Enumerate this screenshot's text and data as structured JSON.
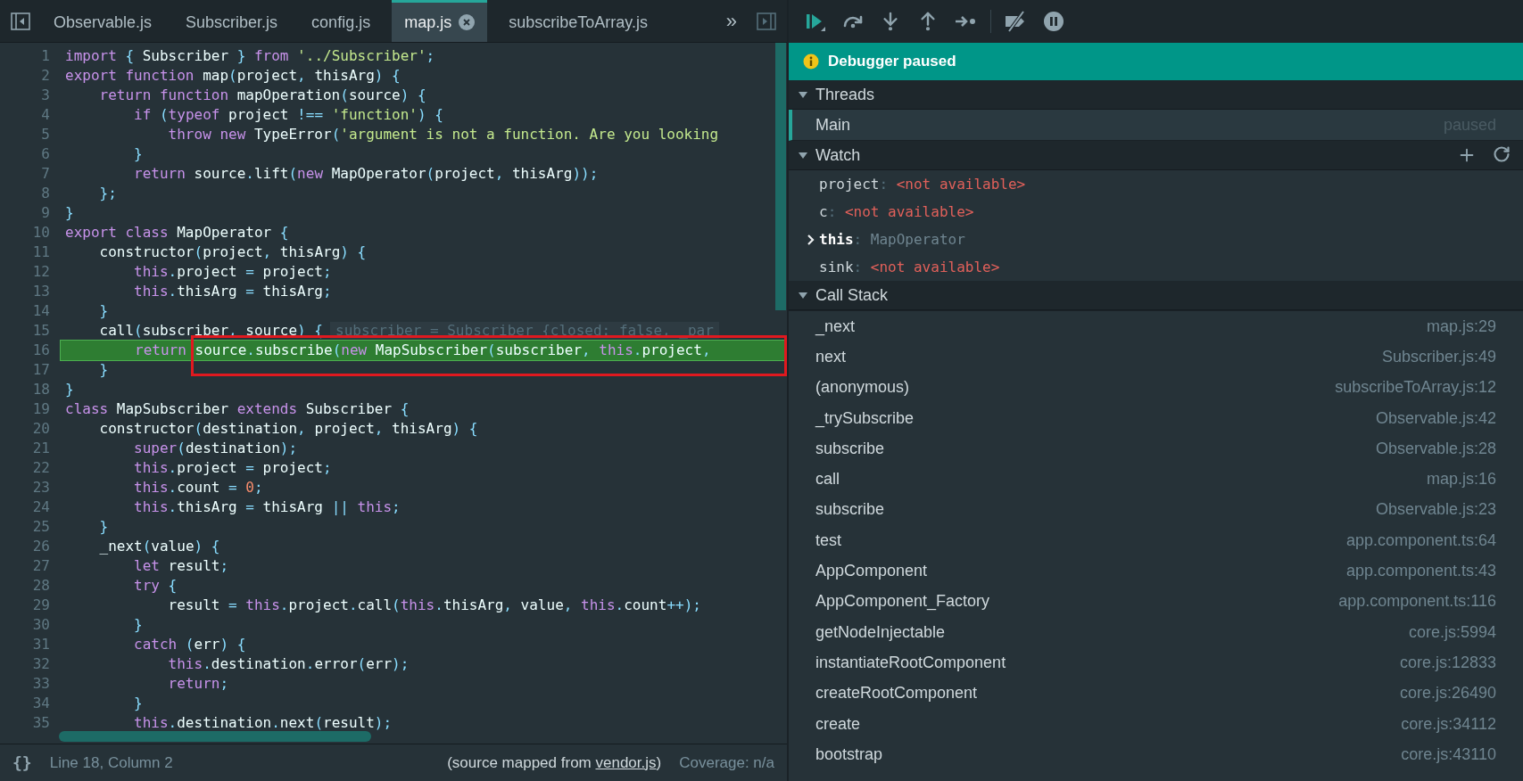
{
  "editor": {
    "tabs": [
      {
        "label": "Observable.js",
        "selected": false,
        "closable": false
      },
      {
        "label": "Subscriber.js",
        "selected": false,
        "closable": false
      },
      {
        "label": "config.js",
        "selected": false,
        "closable": false
      },
      {
        "label": "map.js",
        "selected": true,
        "closable": true
      },
      {
        "label": "subscribeToArray.js",
        "selected": false,
        "closable": false
      }
    ],
    "overflow": "»",
    "lines": [
      {
        "number": "1",
        "paused": false,
        "code": [
          {
            "kind": "keyword",
            "text": "import"
          },
          {
            "kind": "punct",
            "text": " { "
          },
          {
            "kind": "plain",
            "text": "Subscriber"
          },
          {
            "kind": "punct",
            "text": " } "
          },
          {
            "kind": "keyword",
            "text": "from "
          },
          {
            "kind": "string",
            "text": "'../Subscriber'"
          },
          {
            "kind": "punct",
            "text": ";"
          }
        ]
      },
      {
        "number": "2",
        "paused": false,
        "code": [
          {
            "kind": "keyword",
            "text": "export function "
          },
          {
            "kind": "plain",
            "text": "map"
          },
          {
            "kind": "punct",
            "text": "("
          },
          {
            "kind": "plain",
            "text": "project"
          },
          {
            "kind": "punct",
            "text": ", "
          },
          {
            "kind": "plain",
            "text": "thisArg"
          },
          {
            "kind": "punct",
            "text": ") {"
          }
        ]
      },
      {
        "number": "3",
        "paused": false,
        "code": [
          {
            "kind": "keyword",
            "text": "    return function "
          },
          {
            "kind": "plain",
            "text": "mapOperation"
          },
          {
            "kind": "punct",
            "text": "("
          },
          {
            "kind": "plain",
            "text": "source"
          },
          {
            "kind": "punct",
            "text": ") {"
          }
        ]
      },
      {
        "number": "4",
        "paused": false,
        "code": [
          {
            "kind": "keyword",
            "text": "        if "
          },
          {
            "kind": "punct",
            "text": "("
          },
          {
            "kind": "keyword",
            "text": "typeof "
          },
          {
            "kind": "plain",
            "text": "project "
          },
          {
            "kind": "punct",
            "text": "!== "
          },
          {
            "kind": "string",
            "text": "'function'"
          },
          {
            "kind": "punct",
            "text": ") {"
          }
        ]
      },
      {
        "number": "5",
        "paused": false,
        "code": [
          {
            "kind": "keyword",
            "text": "            throw new "
          },
          {
            "kind": "plain",
            "text": "TypeError"
          },
          {
            "kind": "punct",
            "text": "("
          },
          {
            "kind": "string",
            "text": "'argument is not a function. Are you looking"
          }
        ]
      },
      {
        "number": "6",
        "paused": false,
        "code": [
          {
            "kind": "punct",
            "text": "        }"
          }
        ]
      },
      {
        "number": "7",
        "paused": false,
        "code": [
          {
            "kind": "keyword",
            "text": "        return "
          },
          {
            "kind": "plain",
            "text": "source"
          },
          {
            "kind": "punct",
            "text": "."
          },
          {
            "kind": "plain",
            "text": "lift"
          },
          {
            "kind": "punct",
            "text": "("
          },
          {
            "kind": "keyword",
            "text": "new "
          },
          {
            "kind": "plain",
            "text": "MapOperator"
          },
          {
            "kind": "punct",
            "text": "("
          },
          {
            "kind": "plain",
            "text": "project"
          },
          {
            "kind": "punct",
            "text": ", "
          },
          {
            "kind": "plain",
            "text": "thisArg"
          },
          {
            "kind": "punct",
            "text": "));"
          }
        ]
      },
      {
        "number": "8",
        "paused": false,
        "code": [
          {
            "kind": "punct",
            "text": "    };"
          }
        ]
      },
      {
        "number": "9",
        "paused": false,
        "code": [
          {
            "kind": "punct",
            "text": "}"
          }
        ]
      },
      {
        "number": "10",
        "paused": false,
        "code": [
          {
            "kind": "keyword",
            "text": "export class "
          },
          {
            "kind": "plain",
            "text": "MapOperator "
          },
          {
            "kind": "punct",
            "text": "{"
          }
        ]
      },
      {
        "number": "11",
        "paused": false,
        "code": [
          {
            "kind": "plain",
            "text": "    constructor"
          },
          {
            "kind": "punct",
            "text": "("
          },
          {
            "kind": "plain",
            "text": "project"
          },
          {
            "kind": "punct",
            "text": ", "
          },
          {
            "kind": "plain",
            "text": "thisArg"
          },
          {
            "kind": "punct",
            "text": ") {"
          }
        ]
      },
      {
        "number": "12",
        "paused": false,
        "code": [
          {
            "kind": "keyword",
            "text": "        this"
          },
          {
            "kind": "punct",
            "text": "."
          },
          {
            "kind": "plain",
            "text": "project "
          },
          {
            "kind": "punct",
            "text": "= "
          },
          {
            "kind": "plain",
            "text": "project"
          },
          {
            "kind": "punct",
            "text": ";"
          }
        ]
      },
      {
        "number": "13",
        "paused": false,
        "code": [
          {
            "kind": "keyword",
            "text": "        this"
          },
          {
            "kind": "punct",
            "text": "."
          },
          {
            "kind": "plain",
            "text": "thisArg "
          },
          {
            "kind": "punct",
            "text": "= "
          },
          {
            "kind": "plain",
            "text": "thisArg"
          },
          {
            "kind": "punct",
            "text": ";"
          }
        ]
      },
      {
        "number": "14",
        "paused": false,
        "code": [
          {
            "kind": "punct",
            "text": "    }"
          }
        ]
      },
      {
        "number": "15",
        "paused": false,
        "code": [
          {
            "kind": "plain",
            "text": "    call"
          },
          {
            "kind": "punct",
            "text": "("
          },
          {
            "kind": "plain",
            "text": "subscriber"
          },
          {
            "kind": "punct",
            "text": ", "
          },
          {
            "kind": "plain",
            "text": "source"
          },
          {
            "kind": "punct",
            "text": ") {"
          }
        ],
        "preview": "subscriber = Subscriber {closed: false, _par"
      },
      {
        "number": "16",
        "paused": true,
        "code": [
          {
            "kind": "keyword",
            "text": "        return "
          },
          {
            "kind": "plain",
            "text": "source"
          },
          {
            "kind": "punct",
            "text": "."
          },
          {
            "kind": "plain",
            "text": "subscribe"
          },
          {
            "kind": "punct",
            "text": "("
          },
          {
            "kind": "keyword",
            "text": "new "
          },
          {
            "kind": "plain",
            "text": "MapSubscriber"
          },
          {
            "kind": "punct",
            "text": "("
          },
          {
            "kind": "plain",
            "text": "subscriber"
          },
          {
            "kind": "punct",
            "text": ", "
          },
          {
            "kind": "keyword",
            "text": "this"
          },
          {
            "kind": "punct",
            "text": "."
          },
          {
            "kind": "plain",
            "text": "project"
          },
          {
            "kind": "punct",
            "text": ", "
          }
        ]
      },
      {
        "number": "17",
        "paused": false,
        "code": [
          {
            "kind": "punct",
            "text": "    }"
          }
        ]
      },
      {
        "number": "18",
        "paused": false,
        "code": [
          {
            "kind": "punct",
            "text": "}"
          }
        ]
      },
      {
        "number": "19",
        "paused": false,
        "code": [
          {
            "kind": "keyword",
            "text": "class "
          },
          {
            "kind": "plain",
            "text": "MapSubscriber "
          },
          {
            "kind": "keyword",
            "text": "extends "
          },
          {
            "kind": "plain",
            "text": "Subscriber "
          },
          {
            "kind": "punct",
            "text": "{"
          }
        ]
      },
      {
        "number": "20",
        "paused": false,
        "code": [
          {
            "kind": "plain",
            "text": "    constructor"
          },
          {
            "kind": "punct",
            "text": "("
          },
          {
            "kind": "plain",
            "text": "destination"
          },
          {
            "kind": "punct",
            "text": ", "
          },
          {
            "kind": "plain",
            "text": "project"
          },
          {
            "kind": "punct",
            "text": ", "
          },
          {
            "kind": "plain",
            "text": "thisArg"
          },
          {
            "kind": "punct",
            "text": ") {"
          }
        ]
      },
      {
        "number": "21",
        "paused": false,
        "code": [
          {
            "kind": "keyword",
            "text": "        super"
          },
          {
            "kind": "punct",
            "text": "("
          },
          {
            "kind": "plain",
            "text": "destination"
          },
          {
            "kind": "punct",
            "text": ");"
          }
        ]
      },
      {
        "number": "22",
        "paused": false,
        "code": [
          {
            "kind": "keyword",
            "text": "        this"
          },
          {
            "kind": "punct",
            "text": "."
          },
          {
            "kind": "plain",
            "text": "project "
          },
          {
            "kind": "punct",
            "text": "= "
          },
          {
            "kind": "plain",
            "text": "project"
          },
          {
            "kind": "punct",
            "text": ";"
          }
        ]
      },
      {
        "number": "23",
        "paused": false,
        "code": [
          {
            "kind": "keyword",
            "text": "        this"
          },
          {
            "kind": "punct",
            "text": "."
          },
          {
            "kind": "plain",
            "text": "count "
          },
          {
            "kind": "punct",
            "text": "= "
          },
          {
            "kind": "number",
            "text": "0"
          },
          {
            "kind": "punct",
            "text": ";"
          }
        ]
      },
      {
        "number": "24",
        "paused": false,
        "code": [
          {
            "kind": "keyword",
            "text": "        this"
          },
          {
            "kind": "punct",
            "text": "."
          },
          {
            "kind": "plain",
            "text": "thisArg "
          },
          {
            "kind": "punct",
            "text": "= "
          },
          {
            "kind": "plain",
            "text": "thisArg "
          },
          {
            "kind": "punct",
            "text": "|| "
          },
          {
            "kind": "keyword",
            "text": "this"
          },
          {
            "kind": "punct",
            "text": ";"
          }
        ]
      },
      {
        "number": "25",
        "paused": false,
        "code": [
          {
            "kind": "punct",
            "text": "    }"
          }
        ]
      },
      {
        "number": "26",
        "paused": false,
        "code": [
          {
            "kind": "plain",
            "text": "    _next"
          },
          {
            "kind": "punct",
            "text": "("
          },
          {
            "kind": "plain",
            "text": "value"
          },
          {
            "kind": "punct",
            "text": ") {"
          }
        ]
      },
      {
        "number": "27",
        "paused": false,
        "code": [
          {
            "kind": "keyword",
            "text": "        let "
          },
          {
            "kind": "plain",
            "text": "result"
          },
          {
            "kind": "punct",
            "text": ";"
          }
        ]
      },
      {
        "number": "28",
        "paused": false,
        "code": [
          {
            "kind": "keyword",
            "text": "        try "
          },
          {
            "kind": "punct",
            "text": "{"
          }
        ]
      },
      {
        "number": "29",
        "paused": false,
        "code": [
          {
            "kind": "plain",
            "text": "            result "
          },
          {
            "kind": "punct",
            "text": "= "
          },
          {
            "kind": "keyword",
            "text": "this"
          },
          {
            "kind": "punct",
            "text": "."
          },
          {
            "kind": "plain",
            "text": "project"
          },
          {
            "kind": "punct",
            "text": "."
          },
          {
            "kind": "plain",
            "text": "call"
          },
          {
            "kind": "punct",
            "text": "("
          },
          {
            "kind": "keyword",
            "text": "this"
          },
          {
            "kind": "punct",
            "text": "."
          },
          {
            "kind": "plain",
            "text": "thisArg"
          },
          {
            "kind": "punct",
            "text": ", "
          },
          {
            "kind": "plain",
            "text": "value"
          },
          {
            "kind": "punct",
            "text": ", "
          },
          {
            "kind": "keyword",
            "text": "this"
          },
          {
            "kind": "punct",
            "text": "."
          },
          {
            "kind": "plain",
            "text": "count"
          },
          {
            "kind": "punct",
            "text": "++);"
          }
        ]
      },
      {
        "number": "30",
        "paused": false,
        "code": [
          {
            "kind": "punct",
            "text": "        }"
          }
        ]
      },
      {
        "number": "31",
        "paused": false,
        "code": [
          {
            "kind": "keyword",
            "text": "        catch "
          },
          {
            "kind": "punct",
            "text": "("
          },
          {
            "kind": "plain",
            "text": "err"
          },
          {
            "kind": "punct",
            "text": ") {"
          }
        ]
      },
      {
        "number": "32",
        "paused": false,
        "code": [
          {
            "kind": "keyword",
            "text": "            this"
          },
          {
            "kind": "punct",
            "text": "."
          },
          {
            "kind": "plain",
            "text": "destination"
          },
          {
            "kind": "punct",
            "text": "."
          },
          {
            "kind": "plain",
            "text": "error"
          },
          {
            "kind": "punct",
            "text": "("
          },
          {
            "kind": "plain",
            "text": "err"
          },
          {
            "kind": "punct",
            "text": ");"
          }
        ]
      },
      {
        "number": "33",
        "paused": false,
        "code": [
          {
            "kind": "keyword",
            "text": "            return"
          },
          {
            "kind": "punct",
            "text": ";"
          }
        ]
      },
      {
        "number": "34",
        "paused": false,
        "code": [
          {
            "kind": "punct",
            "text": "        }"
          }
        ]
      },
      {
        "number": "35",
        "paused": false,
        "code": [
          {
            "kind": "keyword",
            "text": "        this"
          },
          {
            "kind": "punct",
            "text": "."
          },
          {
            "kind": "plain",
            "text": "destination"
          },
          {
            "kind": "punct",
            "text": "."
          },
          {
            "kind": "plain",
            "text": "next"
          },
          {
            "kind": "punct",
            "text": "("
          },
          {
            "kind": "plain",
            "text": "result"
          },
          {
            "kind": "punct",
            "text": ");"
          }
        ]
      }
    ],
    "status": {
      "format_icon": "{}",
      "position": "Line 18, Column 2",
      "source_prefix": "(source mapped from ",
      "source_link": "vendor.js",
      "source_suffix": ")",
      "coverage": "Coverage: n/a"
    }
  },
  "debugger": {
    "banner": "Debugger paused",
    "threads": {
      "title": "Threads",
      "expanded": true,
      "items": [
        {
          "name": "Main",
          "status": "paused",
          "selected": true
        }
      ]
    },
    "watch": {
      "title": "Watch",
      "expanded": true,
      "items": [
        {
          "kind": "unavailable",
          "name": "project",
          "separator": ":",
          "value": "<not available>",
          "expandable": false
        },
        {
          "kind": "unavailable",
          "name": "c",
          "separator": ":",
          "value": "<not available>",
          "expandable": false
        },
        {
          "kind": "object",
          "name": "this",
          "separator": ":",
          "value": "MapOperator",
          "expandable": true
        },
        {
          "kind": "unavailable",
          "name": "sink",
          "separator": ":",
          "value": "<not available>",
          "expandable": false
        }
      ]
    },
    "call_stack": {
      "title": "Call Stack",
      "expanded": true,
      "frames": [
        {
          "function": "_next",
          "location": "map.js:29"
        },
        {
          "function": "next",
          "location": "Subscriber.js:49"
        },
        {
          "function": "(anonymous)",
          "location": "subscribeToArray.js:12"
        },
        {
          "function": "_trySubscribe",
          "location": "Observable.js:42"
        },
        {
          "function": "subscribe",
          "location": "Observable.js:28"
        },
        {
          "function": "call",
          "location": "map.js:16"
        },
        {
          "function": "subscribe",
          "location": "Observable.js:23"
        },
        {
          "function": "test",
          "location": "app.component.ts:64"
        },
        {
          "function": "AppComponent",
          "location": "app.component.ts:43"
        },
        {
          "function": "AppComponent_Factory",
          "location": "app.component.ts:116"
        },
        {
          "function": "getNodeInjectable",
          "location": "core.js:5994"
        },
        {
          "function": "instantiateRootComponent",
          "location": "core.js:12833"
        },
        {
          "function": "createRootComponent",
          "location": "core.js:26490"
        },
        {
          "function": "create",
          "location": "core.js:34112"
        },
        {
          "function": "bootstrap",
          "location": "core.js:43110"
        }
      ]
    }
  }
}
